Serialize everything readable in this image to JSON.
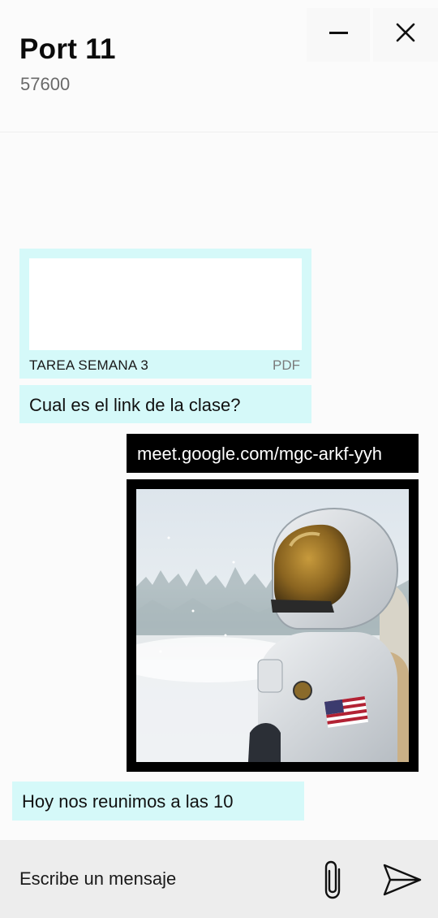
{
  "header": {
    "title": "Port 11",
    "subtitle": "57600",
    "minimize_icon": "minus-icon",
    "close_icon": "close-icon"
  },
  "messages": [
    {
      "type": "file",
      "direction": "incoming",
      "file_name": "TAREA SEMANA 3",
      "file_ext": "PDF"
    },
    {
      "type": "text",
      "direction": "incoming",
      "text": "Cual es el link de la clase?"
    },
    {
      "type": "text",
      "direction": "outgoing",
      "text": "meet.google.com/mgc-arkf-yyh"
    },
    {
      "type": "image",
      "direction": "outgoing",
      "image": "astronaut-in-snow-photo"
    },
    {
      "type": "text",
      "direction": "incoming",
      "text": "Hoy nos reunimos a las 10"
    }
  ],
  "composer": {
    "placeholder": "Escribe un mensaje",
    "attach_icon": "paperclip-icon",
    "send_icon": "send-icon"
  },
  "colors": {
    "incoming_bubble": "#d5f9f9",
    "outgoing_bubble": "#000000",
    "background": "#fbfbfb",
    "composer_bg": "#ededed"
  }
}
